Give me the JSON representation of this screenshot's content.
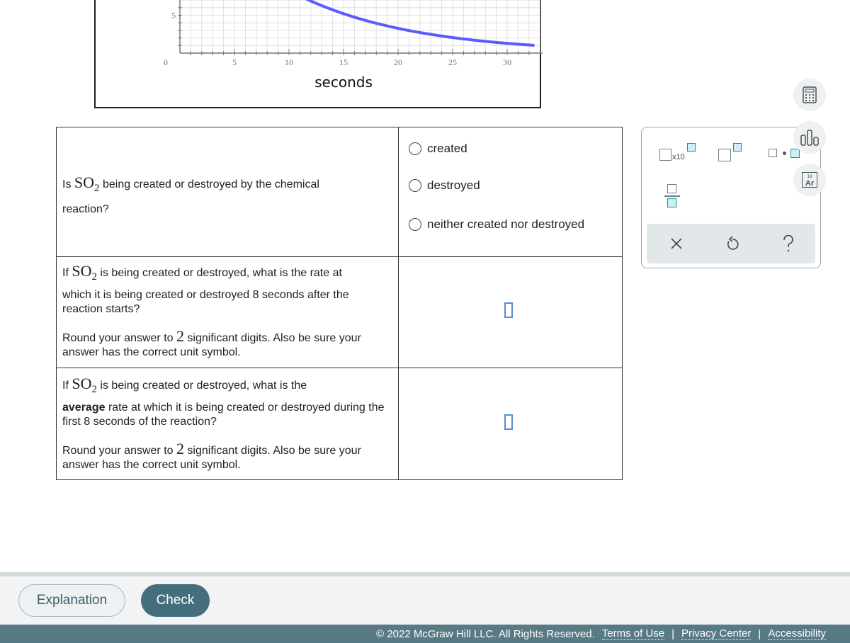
{
  "chart_data": {
    "type": "line",
    "xlabel": "seconds",
    "x_ticks": [
      "0",
      "5",
      "10",
      "15",
      "20",
      "25",
      "30"
    ],
    "y_ticks": [
      "5"
    ],
    "xlim": [
      0,
      33
    ],
    "grid": true,
    "color": "#5b5bff",
    "points": [
      [
        12,
        6.9
      ],
      [
        15,
        5.2
      ],
      [
        20,
        3.3
      ],
      [
        25,
        2.1
      ],
      [
        30,
        1.3
      ],
      [
        32,
        1.1
      ]
    ]
  },
  "questions": [
    {
      "pre": "Is ",
      "chem": "SO",
      "sub": "2",
      "post": " being created or destroyed by the chemical",
      "line2": "reaction?"
    },
    {
      "pre": "If ",
      "chem": "SO",
      "sub": "2",
      "post": " is being created or destroyed, what is the rate at",
      "line2": "which it is being created or destroyed 8 seconds after the reaction starts?",
      "round_pre": "Round your answer to ",
      "digits": "2",
      "round_post": " significant digits. Also be sure your answer has the correct unit symbol."
    },
    {
      "pre": "If ",
      "chem": "SO",
      "sub": "2",
      "post": " is being created or destroyed, what is the",
      "bold": "average",
      "line2": " rate at which it is being created or destroyed during the first 8 seconds of the reaction?",
      "round_pre": "Round your answer to ",
      "digits": "2",
      "round_post": " significant digits. Also be sure your answer has the correct unit symbol."
    }
  ],
  "options": [
    "created",
    "destroyed",
    "neither created nor destroyed"
  ],
  "toolbox": {
    "x10": "x10",
    "element_num": "18",
    "element_sym": "Ar"
  },
  "buttons": {
    "explanation": "Explanation",
    "check": "Check"
  },
  "footer": {
    "copyright": "© 2022 McGraw Hill LLC. All Rights Reserved.",
    "terms": "Terms of Use",
    "privacy": "Privacy Center",
    "accessibility": "Accessibility",
    "sep": "|"
  },
  "colors": {
    "accent": "#456e7c",
    "footer": "#587a85",
    "curve": "#5b5bff",
    "input": "#5a8be0"
  }
}
